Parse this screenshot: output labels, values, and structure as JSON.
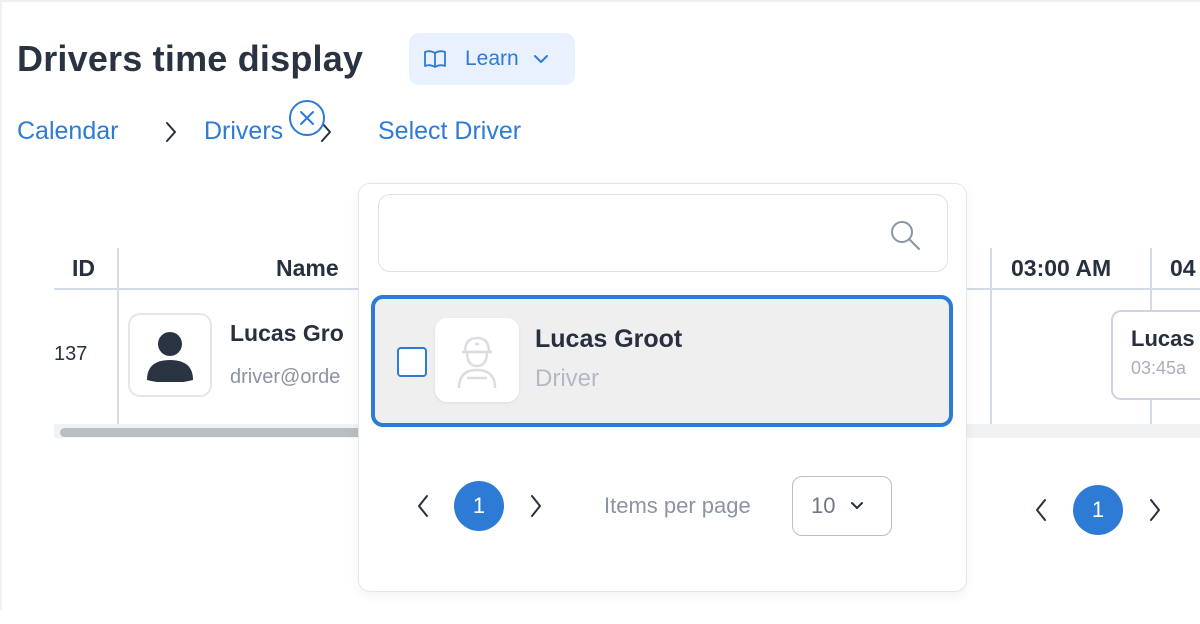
{
  "header": {
    "title": "Drivers time display",
    "learn_label": "Learn"
  },
  "breadcrumb": {
    "items": [
      "Calendar",
      "Drivers",
      "Select Driver"
    ]
  },
  "table": {
    "columns": [
      "ID",
      "Name",
      "03:00 AM",
      "04"
    ],
    "rows": [
      {
        "id": "137",
        "name": "Lucas Gro",
        "email": "driver@orde"
      }
    ],
    "event": {
      "name": "Lucas",
      "time": "03:45a"
    },
    "pagination": {
      "current_page": "1"
    }
  },
  "driver_picker": {
    "search": {
      "value": "",
      "placeholder": ""
    },
    "options": [
      {
        "name": "Lucas Groot",
        "role": "Driver",
        "checked": false
      }
    ],
    "pagination": {
      "current_page": "1",
      "items_per_page_label": "Items per page",
      "items_per_page_value": "10"
    }
  },
  "colors": {
    "accent": "#2e7bd6",
    "learn_bg": "#e8f1fd",
    "selected_option_bg": "#efefef"
  }
}
